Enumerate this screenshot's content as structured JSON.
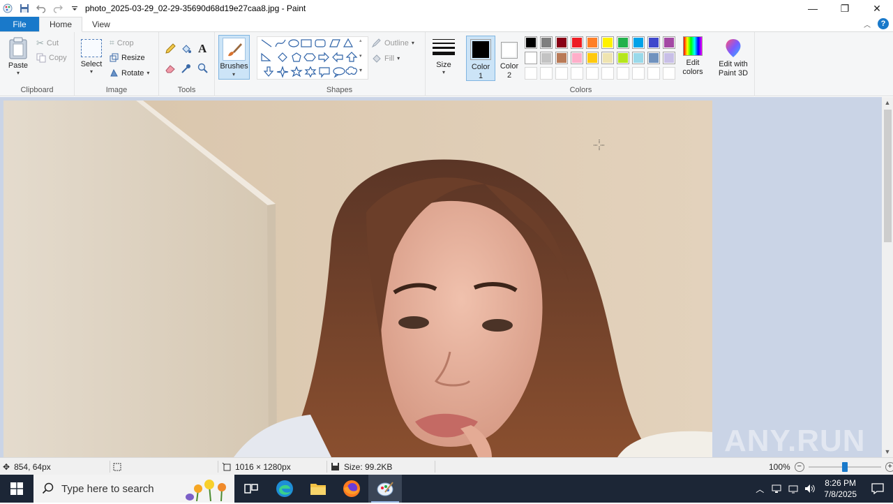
{
  "window": {
    "title": "photo_2025-03-29_02-29-35690d68d19e27caa8.jpg - Paint",
    "min_glyph": "—",
    "restore_glyph": "❐",
    "close_glyph": "✕"
  },
  "tabs": {
    "file": "File",
    "home": "Home",
    "view": "View"
  },
  "ribbon": {
    "clipboard": {
      "label": "Clipboard",
      "paste": "Paste",
      "cut": "Cut",
      "copy": "Copy"
    },
    "image": {
      "label": "Image",
      "select": "Select",
      "crop": "Crop",
      "resize": "Resize",
      "rotate": "Rotate"
    },
    "tools": {
      "label": "Tools"
    },
    "brushes": {
      "label": "Brushes"
    },
    "shapes": {
      "label": "Shapes",
      "outline": "Outline",
      "fill": "Fill"
    },
    "size": {
      "label": "Size"
    },
    "colors": {
      "label": "Colors",
      "color1": "Color\n1",
      "color1_line1": "Color",
      "color1_line2": "1",
      "color2_line1": "Color",
      "color2_line2": "2",
      "edit_line1": "Edit",
      "edit_line2": "colors",
      "paint3d_line1": "Edit with",
      "paint3d_line2": "Paint 3D",
      "palette_row1": [
        "#000000",
        "#7f7f7f",
        "#880015",
        "#ed1c24",
        "#ff7f27",
        "#fff200",
        "#22b14c",
        "#00a2e8",
        "#3f48cc",
        "#a349a4"
      ],
      "palette_row2": [
        "#ffffff",
        "#c3c3c3",
        "#b97a57",
        "#ffaec9",
        "#ffc90e",
        "#efe4b0",
        "#b5e61d",
        "#99d9ea",
        "#7092be",
        "#c8bfe7"
      ],
      "color1_value": "#000000",
      "color2_value": "#ffffff"
    }
  },
  "status": {
    "cursor_pos": "854, 64px",
    "dimensions": "1016 × 1280px",
    "size": "Size: 99.2KB",
    "zoom": "100%",
    "zoom_slider_fraction": 0.5
  },
  "taskbar": {
    "search_placeholder": "Type here to search",
    "time": "8:26 PM",
    "date": "7/8/2025"
  },
  "watermark": "ANY.RUN"
}
